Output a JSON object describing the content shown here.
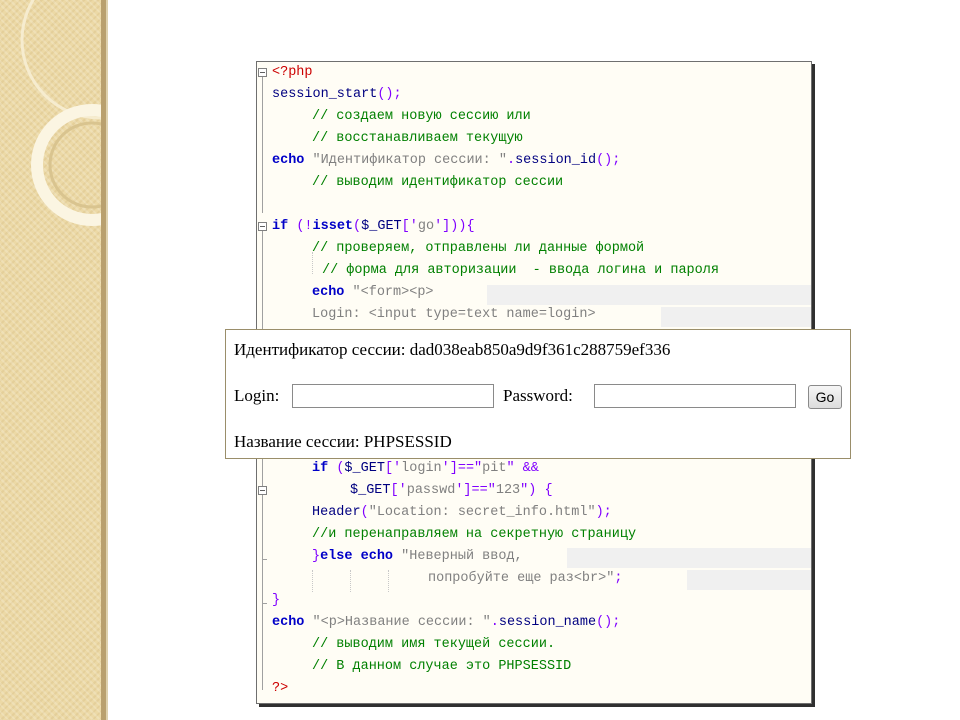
{
  "code": {
    "line1": {
      "tag": "<?php"
    },
    "line2": {
      "fn": "session_start",
      "paren": "();"
    },
    "line3": {
      "comment": "// создаем новую сессию или"
    },
    "line4": {
      "comment": "// восстанавливаем текущую"
    },
    "line5": {
      "kw": "echo",
      "str": "\"Идентификатор сессии: \"",
      "op": ".",
      "fn": "session_id",
      "paren": "();"
    },
    "line6": {
      "comment": "// выводим идентификатор сессии"
    },
    "line8": {
      "kw": "if",
      "pre": "(!",
      "kw2": "isset",
      "mid": "(",
      "var": "$_GET",
      "post": "['",
      "str": "go",
      "end": "'])){"
    },
    "line9": {
      "comment": "// проверяем, отправлены ли данные формой"
    },
    "line10": {
      "comment": "// форма для авторизации  - ввода логина и пароля"
    },
    "line11": {
      "kw": "echo",
      "str": "\"<form><p>"
    },
    "line12": {
      "str": "Login: <input type=text name=login>"
    },
    "line15": {
      "kw": "if",
      "pre": "(",
      "var": "$_GET",
      "op": "['",
      "str": "login",
      "post": "']==\"",
      "str2": "pit",
      "end": "\" &&"
    },
    "line16": {
      "var": "$_GET",
      "op": "['",
      "str": "passwd",
      "post": "']==\"",
      "str2": "123",
      "end": "\") {"
    },
    "line17": {
      "fn": "Header",
      "paren": "(",
      "str": "\"Location: secret_info.html\"",
      "end": ");"
    },
    "line18": {
      "comment": "//и перенаправляем на секретную страницу"
    },
    "line19": {
      "brace": "}",
      "kw": "else echo",
      "str": "\"Неверный ввод,"
    },
    "line20": {
      "str": "попробуйте еще раз<br>\"",
      "end": ";"
    },
    "line21": {
      "brace": "}"
    },
    "line22": {
      "kw": "echo",
      "str": "\"<p>Название сессии: \"",
      "op": ".",
      "fn": "session_name",
      "paren": "();"
    },
    "line23": {
      "comment": "// выводим имя текущей сессии."
    },
    "line24": {
      "comment": "// В данном случае это PHPSESSID"
    },
    "line25": {
      "tag": "?>"
    }
  },
  "output": {
    "session_id_text": "Идентификатор сессии: dad038eab850a9d9f361c288759ef336",
    "login_label": "Login:",
    "login_value": "",
    "password_label": "Password:",
    "password_value": "",
    "go_button": "Go",
    "session_name_text": "Название сессии: PHPSESSID"
  },
  "colors": {
    "keyword": "#0000c8",
    "comment": "#008000",
    "string": "#808080",
    "php_tag": "#cc0000",
    "operator": "#8000ff"
  }
}
